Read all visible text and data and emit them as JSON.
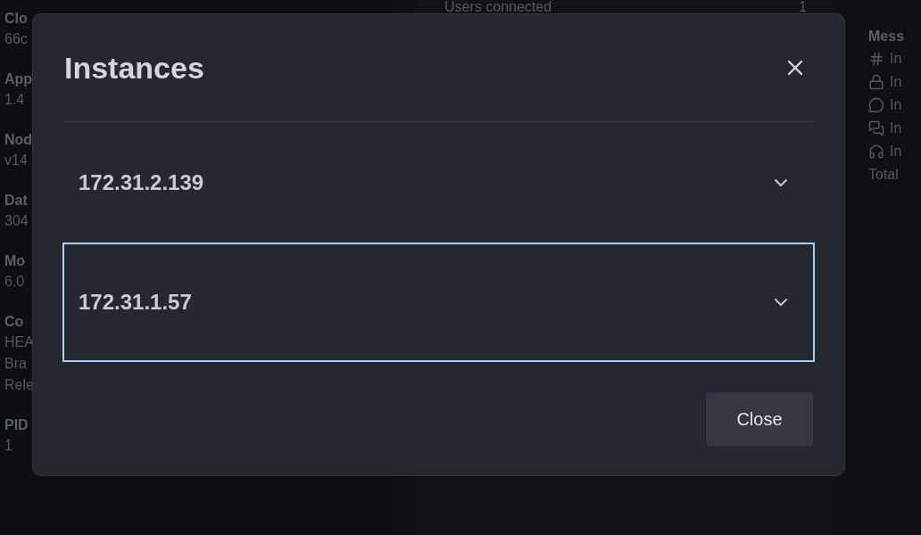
{
  "background": {
    "left_fields": [
      {
        "label": "Clo",
        "lines": [
          "66c"
        ]
      },
      {
        "label": "App",
        "lines": [
          "1.4"
        ]
      },
      {
        "label": "Nod",
        "lines": [
          "v14"
        ]
      },
      {
        "label": "Dat",
        "lines": [
          "304"
        ]
      },
      {
        "label": "Mo",
        "lines": [
          "6.0"
        ]
      },
      {
        "label": "Co",
        "lines": [
          "HEA",
          "Bra",
          "Rele"
        ]
      },
      {
        "label": "PID",
        "lines": [
          "1"
        ]
      }
    ],
    "middle_row": {
      "label": "Users connected",
      "value": "1"
    },
    "right": {
      "title": "Mess",
      "items": [
        {
          "kind": "public",
          "text": "In"
        },
        {
          "kind": "private",
          "text": "In"
        },
        {
          "kind": "direct",
          "text": "In"
        },
        {
          "kind": "discussion",
          "text": "In"
        },
        {
          "kind": "omnichannel",
          "text": "In"
        }
      ],
      "total": "Total"
    }
  },
  "dialog": {
    "title": "Instances",
    "items": [
      {
        "label": "172.31.2.139",
        "focused": false
      },
      {
        "label": "172.31.1.57",
        "focused": true
      }
    ],
    "button": "Close"
  }
}
